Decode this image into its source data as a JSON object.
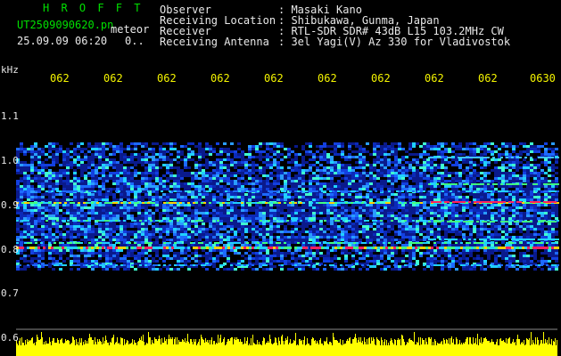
{
  "header": {
    "title": "H R O F F T",
    "filename": "UT2509090620.pn",
    "mode": "meteor",
    "datetime": "25.09.09 06:20",
    "counter": "0.."
  },
  "info": {
    "rows": [
      {
        "label": "Observer",
        "value": ": Masaki Kano"
      },
      {
        "label": "Receiving Location",
        "value": ": Shibukawa, Gunma, Japan"
      },
      {
        "label": "Receiver",
        "value": ": RTL-SDR SDR# 43dB L15 103.2MHz CW"
      },
      {
        "label": "Receiving Antenna",
        "value": ": 3el Yagi(V) Az 330 for Vladivostok"
      }
    ]
  },
  "axis": {
    "unit": "kHz",
    "y_ticks": [
      "1.1",
      "1.0",
      "0.9",
      "0.8",
      "0.7",
      "0.6"
    ],
    "time_ticks": [
      "062",
      "062",
      "062",
      "062",
      "062",
      "062",
      "062",
      "062",
      "062",
      "0630"
    ]
  },
  "colors": {
    "background": "#000000",
    "header_text": "#00e000",
    "info_text": "#e8e8e8",
    "time_text": "#f4f400",
    "echo_trace": "#ffff00"
  }
}
